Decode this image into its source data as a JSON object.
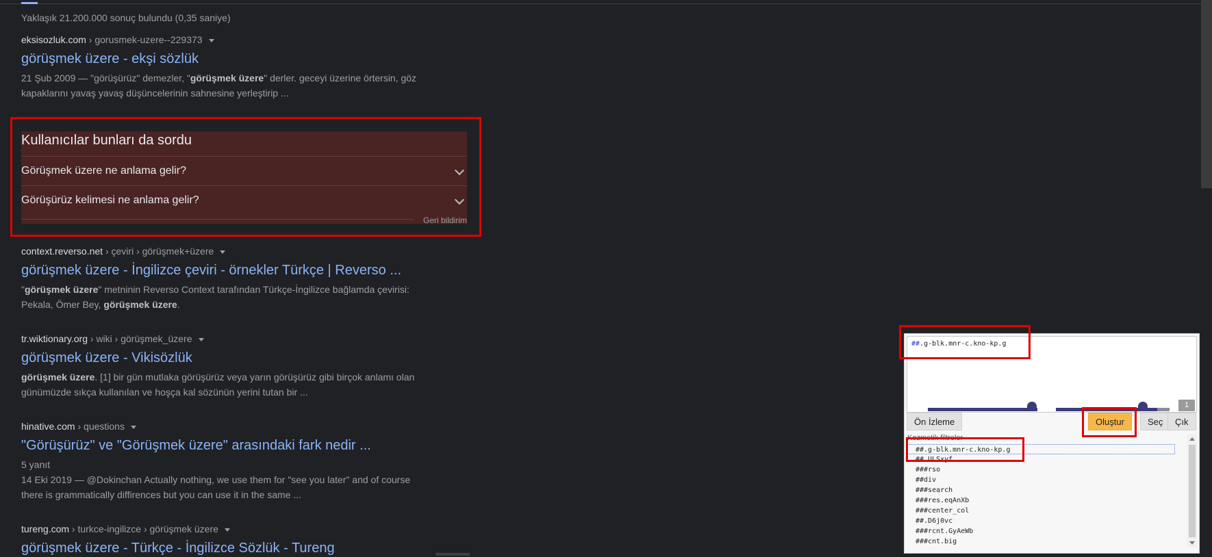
{
  "stats": "Yaklaşık 21.200.000 sonuç bulundu (0,35 saniye)",
  "results": [
    {
      "domain": "eksisozluk.com",
      "path": " › gorusmek-uzere--229373",
      "title": "görüşmek üzere - ekşi sözlük",
      "snippet_html": "21 Şub 2009 — \"görüşürüz\" demezler, \"<b>görüşmek üzere</b>\" derler. geceyi üzerine örtersin, göz kapaklarını yavaş yavaş düşüncelerinin sahnesine yerleştirip ..."
    },
    {
      "domain": "context.reverso.net",
      "path": " › çeviri › görüşmek+üzere",
      "title": "görüşmek üzere - İngilizce çeviri - örnekler Türkçe | Reverso ...",
      "snippet_html": "\"<b>görüşmek üzere</b>\" metninin Reverso Context tarafından Türkçe-İngilizce bağlamda çevirisi: Pekala, Ömer Bey, <b>görüşmek üzere</b>."
    },
    {
      "domain": "tr.wiktionary.org",
      "path": " › wiki › görüşmek_üzere",
      "title": "görüşmek üzere - Vikisözlük",
      "snippet_html": "<b>görüşmek üzere</b>. [1] bir gün mutlaka görüşürüz veya yarın görüşürüz gibi birçok anlamı olan günümüzde sıkça kullanılan ve hoşça kal sözünün yerini tutan bir ..."
    },
    {
      "domain": "hinative.com",
      "path": " › questions",
      "title": "\"Görüşürüz\" ve \"Görüşmek üzere\" arasındaki fark nedir ...",
      "snippet_html": "5 yanıt<br>14 Eki 2019 — @Dokinchan Actually nothing, we use them for \"see you later\" and of course there is grammatically diffirences but you can use it in the same ..."
    },
    {
      "domain": "tureng.com",
      "path": " › turkce-ingilizce › görüşmek üzere",
      "title": "görüşmek üzere - Türkçe - İngilizce Sözlük - Tureng",
      "snippet_html": ""
    }
  ],
  "paa": {
    "heading": "Kullanıcılar bunları da sordu",
    "questions": [
      "Görüşmek üzere ne anlama gelir?",
      "Görüşürüz kelimesi ne anlama gelir?"
    ],
    "feedback": "Geri bildirim"
  },
  "picker": {
    "filter_text": ".g-blk.mnr-c.kno-kp.g",
    "filter_prefix": "##",
    "match_count": "1",
    "buttons": {
      "preview": "Ön İzleme",
      "create": "Oluştur",
      "select": "Seç",
      "quit": "Çık"
    },
    "list_label": "Kozmetik filtreler",
    "list_items": [
      "##.g-blk.mnr-c.kno-kp.g",
      "##.ULSxyf",
      "###rso",
      "##div",
      "###search",
      "###res.eqAnXb",
      "###center_col",
      "##.D6j0vc",
      "###rcnt.GyAeWb",
      "###cnt.big"
    ],
    "colors": {
      "create_button": "#f7b84b",
      "highlight_red": "#e00000",
      "slider": "#3b3b7a"
    }
  }
}
